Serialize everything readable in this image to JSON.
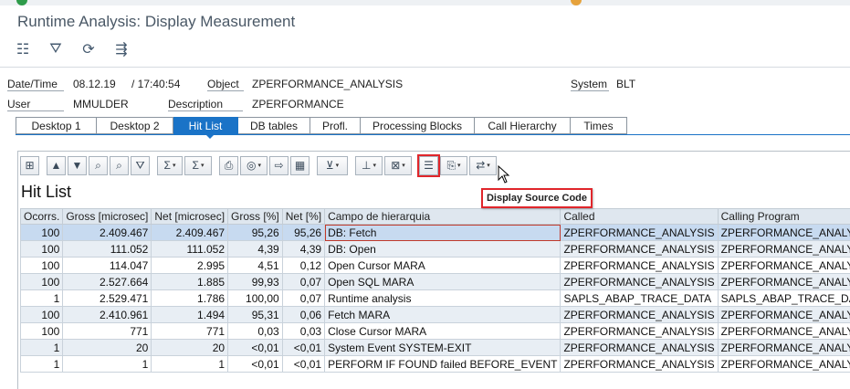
{
  "window": {
    "title": "Runtime Analysis: Display Measurement"
  },
  "appbar": {
    "icons": [
      "settings-list-icon",
      "filter-icon",
      "refresh-icon",
      "split-icon"
    ]
  },
  "header": {
    "datetime_label": "Date/Time",
    "date_value": "08.12.19",
    "time_value": "/ 17:40:54",
    "object_label": "Object",
    "object_value": "ZPERFORMANCE_ANALYSIS",
    "system_label": "System",
    "system_value": "BLT",
    "user_label": "User",
    "user_value": "MMULDER",
    "description_label": "Description",
    "description_value": "ZPERFORMANCE"
  },
  "tabs": [
    "Desktop 1",
    "Desktop 2",
    "Hit List",
    "DB tables",
    "Profl.",
    "Processing Blocks",
    "Call Hierarchy",
    "Times"
  ],
  "active_tab": "Hit List",
  "list": {
    "title": "Hit List"
  },
  "tooltip": {
    "text": "Display Source Code"
  },
  "table": {
    "columns": [
      "Ocorrs.",
      "Gross [microsec]",
      "Net [microsec]",
      "Gross [%]",
      "Net [%]",
      "Campo de hierarquia",
      "Called",
      "Calling Program"
    ],
    "rows": [
      [
        "100",
        "2.409.467",
        "2.409.467",
        "95,26",
        "95,26",
        "DB: Fetch",
        "ZPERFORMANCE_ANALYSIS",
        "ZPERFORMANCE_ANALYSIS"
      ],
      [
        "100",
        "111.052",
        "111.052",
        "4,39",
        "4,39",
        "DB: Open",
        "ZPERFORMANCE_ANALYSIS",
        "ZPERFORMANCE_ANALYSIS"
      ],
      [
        "100",
        "114.047",
        "2.995",
        "4,51",
        "0,12",
        "Open Cursor MARA",
        "ZPERFORMANCE_ANALYSIS",
        "ZPERFORMANCE_ANALYSIS"
      ],
      [
        "100",
        "2.527.664",
        "1.885",
        "99,93",
        "0,07",
        "Open SQL MARA",
        "ZPERFORMANCE_ANALYSIS",
        "ZPERFORMANCE_ANALYSIS"
      ],
      [
        "1",
        "2.529.471",
        "1.786",
        "100,00",
        "0,07",
        "Runtime analysis",
        "SAPLS_ABAP_TRACE_DATA",
        "SAPLS_ABAP_TRACE_DATA"
      ],
      [
        "100",
        "2.410.961",
        "1.494",
        "95,31",
        "0,06",
        "Fetch MARA",
        "ZPERFORMANCE_ANALYSIS",
        "ZPERFORMANCE_ANALYSIS"
      ],
      [
        "100",
        "771",
        "771",
        "0,03",
        "0,03",
        "Close Cursor MARA",
        "ZPERFORMANCE_ANALYSIS",
        "ZPERFORMANCE_ANALYSIS"
      ],
      [
        "1",
        "20",
        "20",
        "<0,01",
        "<0,01",
        "System Event SYSTEM-EXIT",
        "ZPERFORMANCE_ANALYSIS",
        "ZPERFORMANCE_ANALYSIS"
      ],
      [
        "1",
        "1",
        "1",
        "<0,01",
        "<0,01",
        "PERFORM IF FOUND failed BEFORE_EVENT",
        "ZPERFORMANCE_ANALYSIS",
        "ZPERFORMANCE_ANALYSIS"
      ]
    ]
  },
  "colors": {
    "accent": "#1a73c7",
    "highlight": "#e0262b",
    "selected_row": "#c7daf0"
  }
}
